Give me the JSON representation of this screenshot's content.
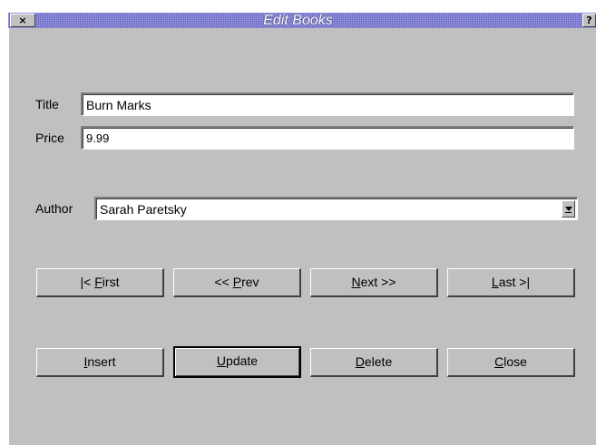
{
  "window": {
    "title": "Edit Books",
    "close_glyph": "×",
    "help_glyph": "?"
  },
  "form": {
    "title_label": "Title",
    "title_value": "Burn Marks",
    "price_label": "Price",
    "price_value": "9.99",
    "author_label": "Author",
    "author_value": "Sarah Paretsky"
  },
  "nav_buttons": {
    "first": {
      "pre": "|< ",
      "mnemonic": "F",
      "post": "irst"
    },
    "prev": {
      "pre": "<< ",
      "mnemonic": "P",
      "post": "rev"
    },
    "next": {
      "pre": "",
      "mnemonic": "N",
      "post": "ext >>"
    },
    "last": {
      "pre": "",
      "mnemonic": "L",
      "post": "ast >|"
    }
  },
  "action_buttons": {
    "insert": {
      "pre": "",
      "mnemonic": "I",
      "post": "nsert"
    },
    "update": {
      "pre": "",
      "mnemonic": "U",
      "post": "pdate"
    },
    "delete": {
      "pre": "",
      "mnemonic": "D",
      "post": "elete"
    },
    "close": {
      "pre": "",
      "mnemonic": "C",
      "post": "lose"
    }
  },
  "colors": {
    "titlebar": "#6866c8",
    "window_bg": "#c0c0c0"
  }
}
